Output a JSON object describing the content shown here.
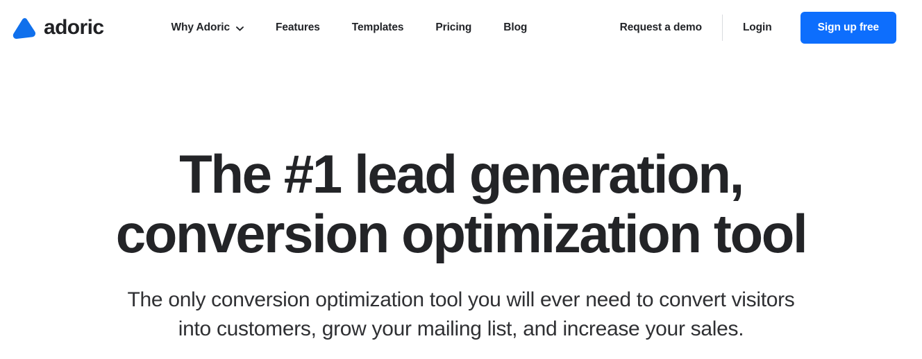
{
  "brand": {
    "name": "adoric",
    "logo_icon": "rounded-triangle-icon",
    "accent_color": "#0d6efd",
    "text_color": "#202124"
  },
  "nav": {
    "items": [
      {
        "label": "Why Adoric",
        "has_dropdown": true,
        "icon": "chevron-down-icon"
      },
      {
        "label": "Features",
        "has_dropdown": false
      },
      {
        "label": "Templates",
        "has_dropdown": false
      },
      {
        "label": "Pricing",
        "has_dropdown": false
      },
      {
        "label": "Blog",
        "has_dropdown": false
      }
    ]
  },
  "actions": {
    "demo_label": "Request a demo",
    "login_label": "Login",
    "signup_label": "Sign up free",
    "signup_bg": "#0d6efd",
    "signup_text_color": "#ffffff"
  },
  "hero": {
    "title_line1": "The #1 lead generation,",
    "title_line2": "conversion optimization tool",
    "subtitle_line1": "The only conversion optimization tool you will ever need to convert",
    "subtitle_line2": "visitors into customers, grow your mailing list, and increase your sales.",
    "title_color": "#232427",
    "subtitle_color": "#2f3033"
  }
}
